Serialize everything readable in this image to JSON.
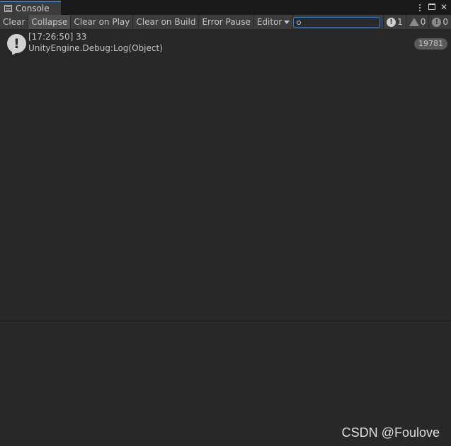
{
  "window": {
    "tab_title": "Console",
    "tab_icon": "console-list-icon",
    "controls": [
      "kebab-menu-icon",
      "maximize-icon",
      "close-icon"
    ],
    "close_glyph": "✕",
    "accent_color": "#3a79bb"
  },
  "toolbar": {
    "clear": "Clear",
    "collapse": "Collapse",
    "clear_on_play": "Clear on Play",
    "clear_on_build": "Clear on Build",
    "error_pause": "Error Pause",
    "editor_dropdown": "Editor",
    "search": {
      "value": "",
      "placeholder": ""
    },
    "counts": {
      "info": "1",
      "warnings": "0",
      "errors": "0"
    }
  },
  "logs": [
    {
      "icon": "info-message-icon",
      "line1": "[17:26:50] 33",
      "line2": "UnityEngine.Debug:Log(Object)",
      "count": "19781"
    }
  ],
  "watermark": "CSDN @Foulove"
}
